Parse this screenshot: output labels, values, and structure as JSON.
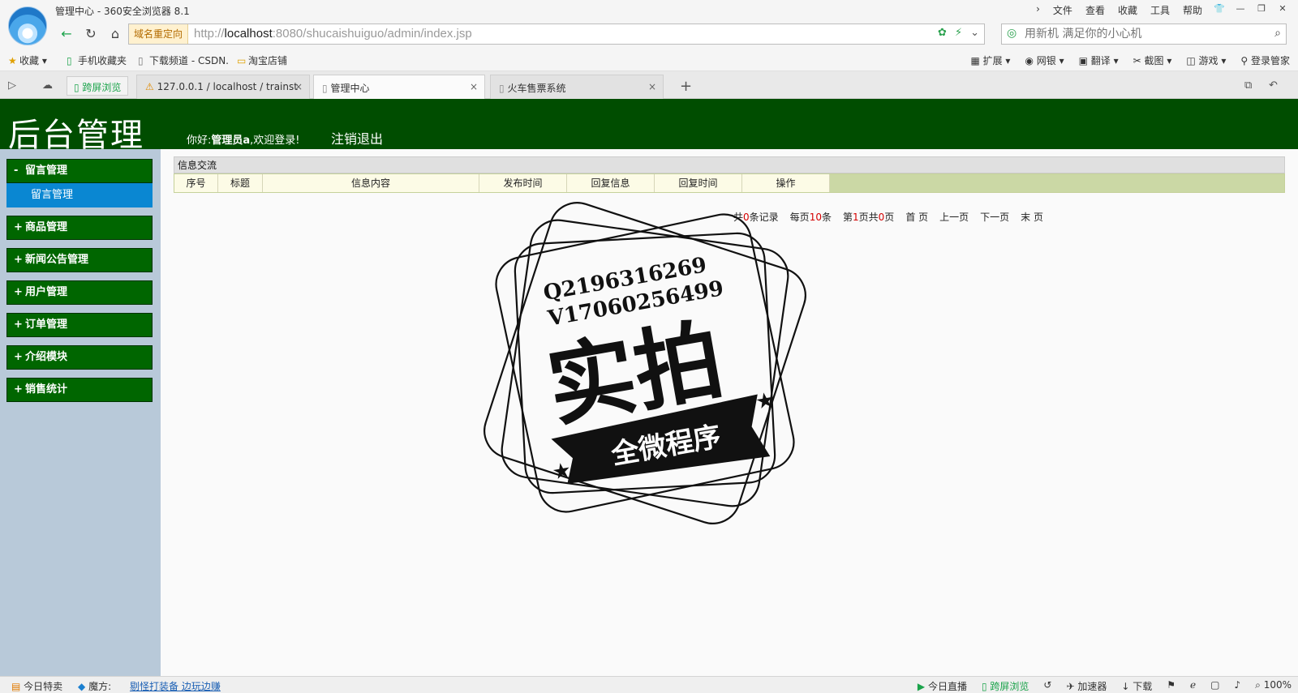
{
  "browser": {
    "window_title": "管理中心 - 360安全浏览器 8.1",
    "menu": [
      "文件",
      "查看",
      "收藏",
      "工具",
      "帮助"
    ],
    "redirect_badge": "域名重定向",
    "url_host_prefix": "http://",
    "url_host": "localhost",
    "url_rest": ":8080/shucaishuiguo/admin/index.jsp",
    "search_placeholder": "用新机 满足你的小心机",
    "bookmarks": [
      "收藏",
      "手机收藏夹",
      "下载频道 - CSDN.",
      "淘宝店铺"
    ],
    "tools": [
      "扩展",
      "网银",
      "翻译",
      "截图",
      "游戏",
      "登录管家"
    ],
    "cross_screen": "跨屏浏览",
    "tabs": [
      {
        "label": "127.0.0.1 / localhost / trainst"
      },
      {
        "label": "管理中心"
      },
      {
        "label": "火车售票系统"
      }
    ]
  },
  "header": {
    "title": "后台管理",
    "greeting_prefix": "你好:",
    "user": "管理员a",
    "greeting_suffix": ",欢迎登录!",
    "logout": "注销退出"
  },
  "sidebar": {
    "items": [
      {
        "sign": "-",
        "label": "留言管理",
        "sub": "留言管理"
      },
      {
        "sign": "+",
        "label": "商品管理"
      },
      {
        "sign": "+",
        "label": "新闻公告管理"
      },
      {
        "sign": "+",
        "label": "用户管理"
      },
      {
        "sign": "+",
        "label": "订单管理"
      },
      {
        "sign": "+",
        "label": "介绍模块"
      },
      {
        "sign": "+",
        "label": "销售统计"
      }
    ]
  },
  "main": {
    "panel_title": "信息交流",
    "columns": [
      "序号",
      "标题",
      "信息内容",
      "发布时间",
      "回复信息",
      "回复时间",
      "操作"
    ],
    "pager": {
      "total_prefix": "共",
      "total": "0",
      "total_suffix": "条记录",
      "per_page_prefix": "每页",
      "per_page": "10",
      "per_page_suffix": "条",
      "page_prefix": "第",
      "current": "1",
      "page_mid": "页共",
      "pages": "0",
      "page_suffix": "页",
      "first": "首 页",
      "prev": "上一页",
      "next": "下一页",
      "last": "末 页"
    }
  },
  "watermark": {
    "line1": "Q2196316269",
    "line2": "V17060256499",
    "big": "实拍",
    "banner": "全微程序"
  },
  "statusbar": {
    "today_deal": "今日特卖",
    "magic_label": "魔方:",
    "magic_link": "剔怪打装备 边玩边赚",
    "live": "今日直播",
    "cross": "跨屏浏览",
    "accelerator": "加速器",
    "download": "下载",
    "zoom": "100%"
  },
  "colors": {
    "header_bg": "#004d00",
    "menu_head_bg": "#006600",
    "menu_sub_bg": "#0a87d2",
    "sidebar_bg": "#b8c9d9",
    "grid_head_bg": "#cbd8a5",
    "pager_number": "#d40000"
  }
}
